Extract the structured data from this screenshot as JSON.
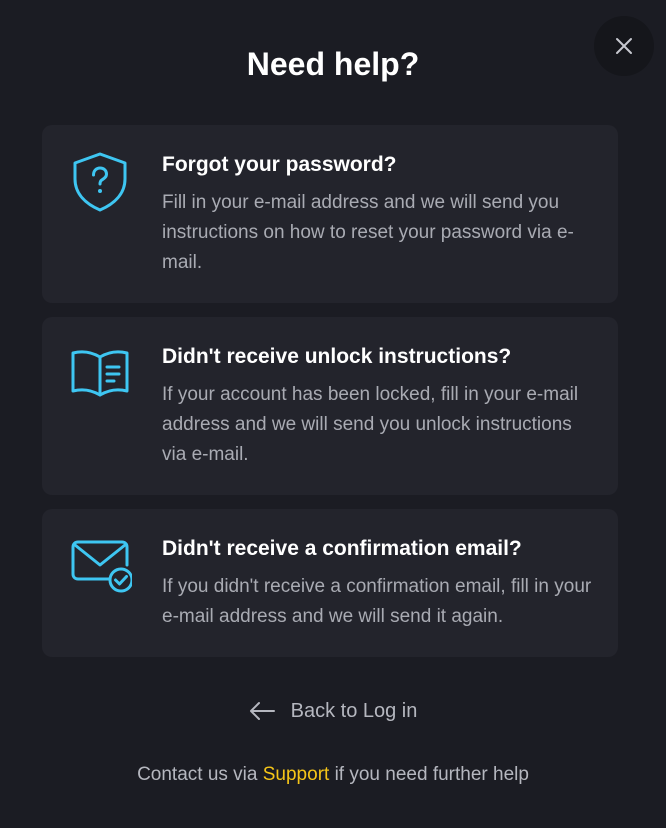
{
  "modal": {
    "title": "Need help?"
  },
  "cards": [
    {
      "icon": "shield-question-icon",
      "title": "Forgot your password?",
      "description": "Fill in your e-mail address and we will send you instructions on how to reset your password via e-mail."
    },
    {
      "icon": "book-icon",
      "title": "Didn't receive unlock instructions?",
      "description": "If your account has been locked, fill in your e-mail address and we will send you unlock instructions via e-mail."
    },
    {
      "icon": "mail-check-icon",
      "title": "Didn't receive a confirmation email?",
      "description": "If you didn't receive a confirmation email, fill in your e-mail address and we will send it again."
    }
  ],
  "back": {
    "label": "Back to Log in"
  },
  "footer": {
    "prefix": "Contact us via",
    "link": "Support",
    "suffix": "if you need further help"
  },
  "colors": {
    "background": "#1b1c23",
    "card": "#23242c",
    "accent_icon": "#3ec6f2",
    "link": "#f5c518",
    "muted_text": "#a9abb3"
  }
}
